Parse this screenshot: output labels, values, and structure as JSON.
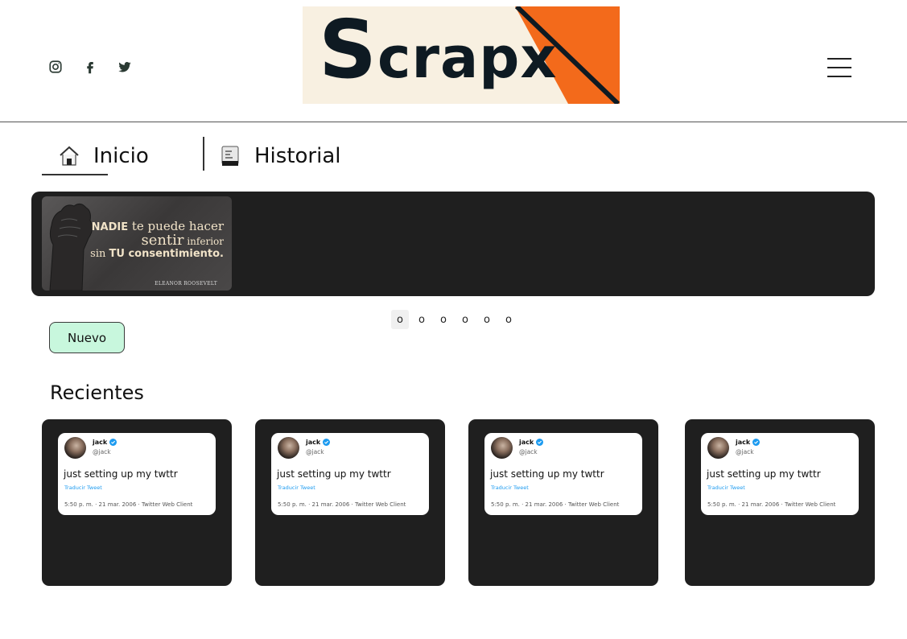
{
  "header": {
    "socials": [
      {
        "name": "instagram-icon"
      },
      {
        "name": "facebook-icon"
      },
      {
        "name": "twitter-icon"
      }
    ],
    "logo": {
      "first_letter": "S",
      "rest": "crapx",
      "colors": {
        "background": "#f8f0e1",
        "accent": "#f36a1b",
        "text": "#0e1a22"
      }
    },
    "menu_icon": "hamburger-menu-icon"
  },
  "tabs": [
    {
      "label": "Inicio",
      "icon": "home-icon",
      "active": true
    },
    {
      "label": "Historial",
      "icon": "history-icon",
      "active": false
    }
  ],
  "carousel": {
    "slide": {
      "line1_bold": "NADIE",
      "line1_rest": " te puede hacer",
      "line2_main": "sentir",
      "line2_small": " inferior",
      "line3_prefix": "sin ",
      "line3_bold": "TU consentimiento.",
      "author": "ELEANOR ROOSEVELT"
    },
    "dots": [
      "o",
      "o",
      "o",
      "o",
      "o",
      "o"
    ],
    "active_dot": 0
  },
  "actions": {
    "new_label": "Nuevo"
  },
  "recent": {
    "title": "Recientes",
    "cards": [
      {
        "name": "jack",
        "handle": "@jack",
        "text": "just setting up my twttr",
        "translate": "Traducir Tweet",
        "meta": "5:50 p. m. · 21 mar. 2006 · Twitter Web Client"
      },
      {
        "name": "jack",
        "handle": "@jack",
        "text": "just setting up my twttr",
        "translate": "Traducir Tweet",
        "meta": "5:50 p. m. · 21 mar. 2006 · Twitter Web Client"
      },
      {
        "name": "jack",
        "handle": "@jack",
        "text": "just setting up my twttr",
        "translate": "Traducir Tweet",
        "meta": "5:50 p. m. · 21 mar. 2006 · Twitter Web Client"
      },
      {
        "name": "jack",
        "handle": "@jack",
        "text": "just setting up my twttr",
        "translate": "Traducir Tweet",
        "meta": "5:50 p. m. · 21 mar. 2006 · Twitter Web Client"
      }
    ]
  }
}
